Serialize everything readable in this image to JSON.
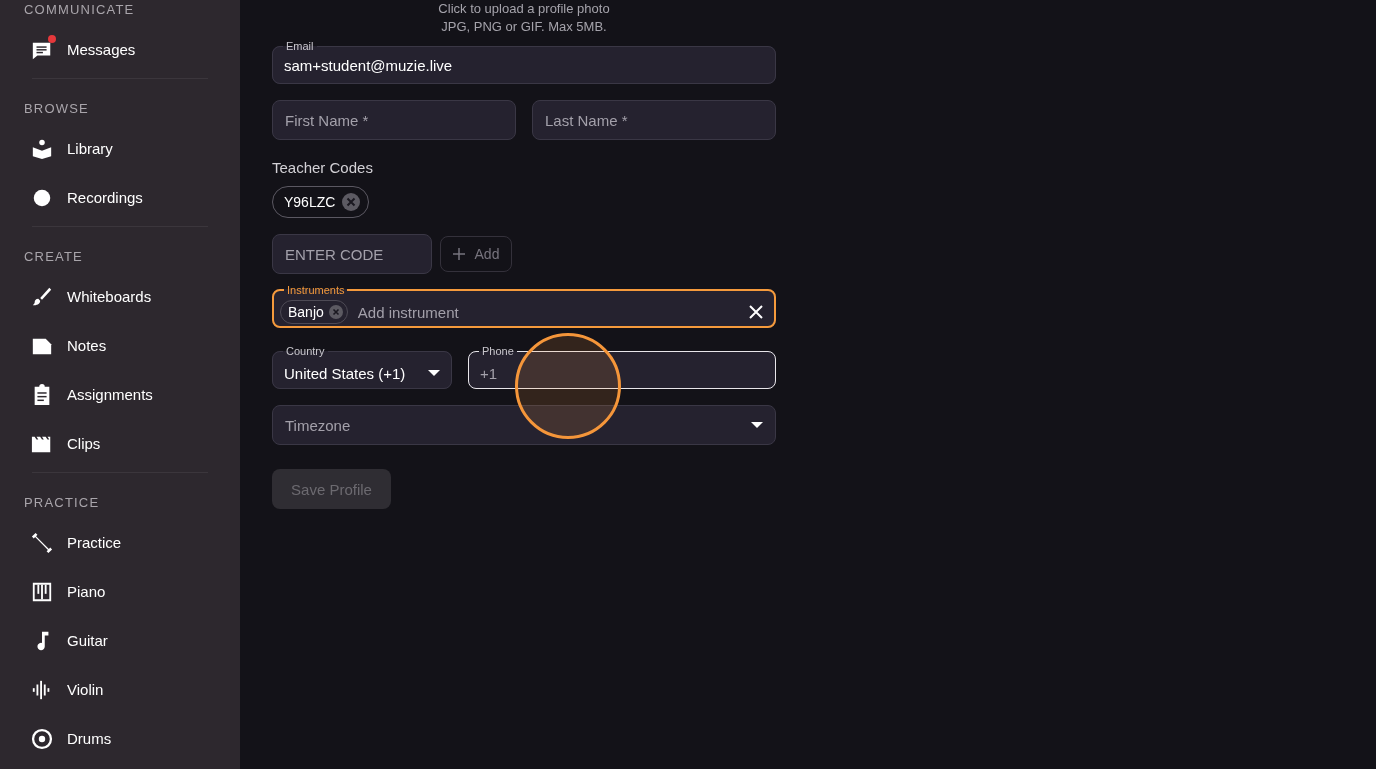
{
  "sidebar": {
    "sections": [
      {
        "title": "COMMUNICATE",
        "items": [
          {
            "label": "Messages",
            "unread": true
          }
        ]
      },
      {
        "title": "BROWSE",
        "items": [
          {
            "label": "Library",
            "unread": false
          },
          {
            "label": "Recordings",
            "unread": false
          }
        ]
      },
      {
        "title": "CREATE",
        "items": [
          {
            "label": "Whiteboards",
            "unread": false
          },
          {
            "label": "Notes",
            "unread": false
          },
          {
            "label": "Assignments",
            "unread": false
          },
          {
            "label": "Clips",
            "unread": false
          }
        ]
      },
      {
        "title": "PRACTICE",
        "items": [
          {
            "label": "Practice",
            "unread": false
          },
          {
            "label": "Piano",
            "unread": false
          },
          {
            "label": "Guitar",
            "unread": false
          },
          {
            "label": "Violin",
            "unread": false
          },
          {
            "label": "Drums",
            "unread": false
          }
        ]
      }
    ]
  },
  "upload_hint": [
    "Click to upload a profile photo",
    "JPG, PNG or GIF. Max 5MB."
  ],
  "email": {
    "label": "Email",
    "value": "sam+student@muzie.live"
  },
  "first_name": {
    "placeholder": "First Name *"
  },
  "last_name": {
    "placeholder": "Last Name *"
  },
  "teacher_codes": {
    "label": "Teacher Codes",
    "codes": [
      "Y96LZC"
    ]
  },
  "code_input": {
    "placeholder": "ENTER CODE"
  },
  "add_button": {
    "label": "Add"
  },
  "instruments": {
    "label": "Instruments",
    "chips": [
      "Banjo"
    ],
    "placeholder": "Add instrument",
    "focused": true
  },
  "country": {
    "label": "Country",
    "value": "United States (+1)"
  },
  "phone": {
    "label": "Phone",
    "value": "+1",
    "focused": true
  },
  "timezone": {
    "placeholder": "Timezone"
  },
  "save_button": {
    "label": "Save Profile",
    "disabled": true
  },
  "click_highlight": true
}
